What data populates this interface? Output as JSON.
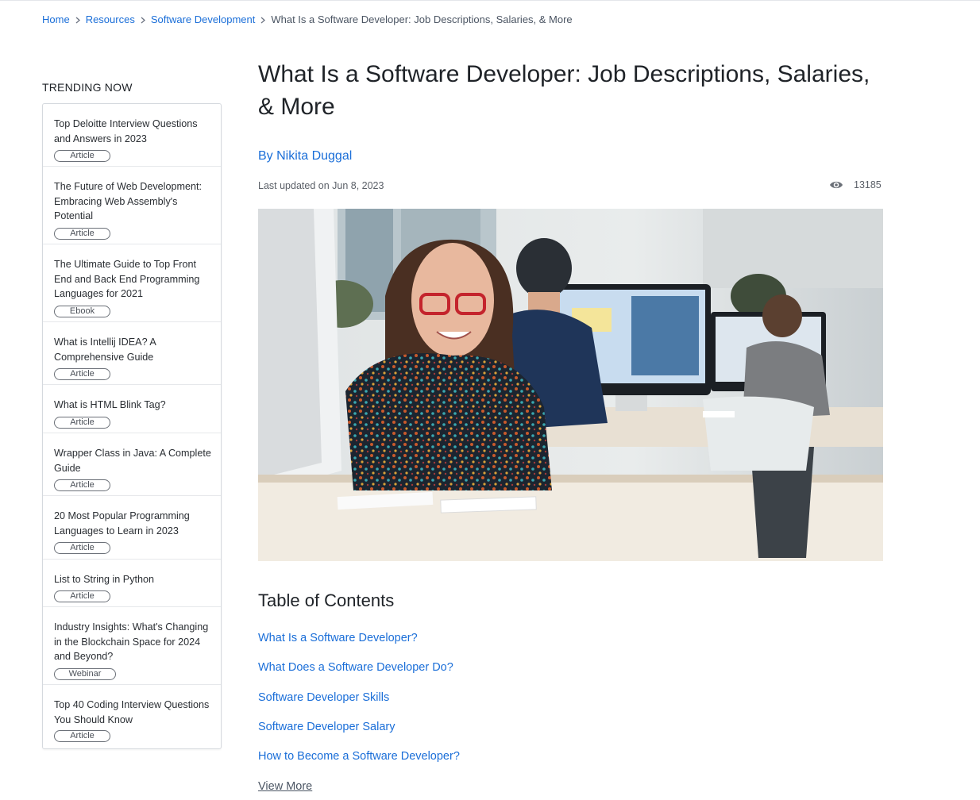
{
  "breadcrumb": {
    "home": "Home",
    "resources": "Resources",
    "category": "Software Development",
    "current": "What Is a Software Developer: Job Descriptions, Salaries, & More"
  },
  "sidebar": {
    "heading": "TRENDING NOW",
    "items": [
      {
        "title": "Top Deloitte Interview Questions and Answers in 2023",
        "tag": "Article"
      },
      {
        "title": "The Future of Web Development: Embracing Web Assembly's Potential",
        "tag": "Article"
      },
      {
        "title": "The Ultimate Guide to Top Front End and Back End Programming Languages for 2021",
        "tag": "Ebook"
      },
      {
        "title": "What is Intellij IDEA? A Comprehensive Guide",
        "tag": "Article"
      },
      {
        "title": "What is HTML Blink Tag?",
        "tag": "Article"
      },
      {
        "title": "Wrapper Class in Java: A Complete Guide",
        "tag": "Article"
      },
      {
        "title": "20 Most Popular Programming Languages to Learn in 2023",
        "tag": "Article"
      },
      {
        "title": "List to String in Python",
        "tag": "Article"
      },
      {
        "title": "Industry Insights: What's Changing in the Blockchain Space for 2024 and Beyond?",
        "tag": "Webinar"
      },
      {
        "title": "Top 40 Coding Interview Questions You Should Know",
        "tag": "Article"
      }
    ]
  },
  "article": {
    "title": "What Is a Software Developer: Job Descriptions, Salaries, & More",
    "author": "By Nikita Duggal",
    "updated": "Last updated on Jun 8, 2023",
    "views": "13185",
    "views_icon": "eye-icon"
  },
  "toc": {
    "heading": "Table of Contents",
    "items": [
      "What Is a Software Developer?",
      "What Does a Software Developer Do?",
      "Software Developer Skills",
      "Software Developer Salary",
      "How to Become a Software Developer?"
    ],
    "view_more": "View More"
  },
  "colors": {
    "link": "#1a6ed8",
    "text": "#1f2328",
    "muted": "#5b6068",
    "border": "#d5d9de"
  }
}
